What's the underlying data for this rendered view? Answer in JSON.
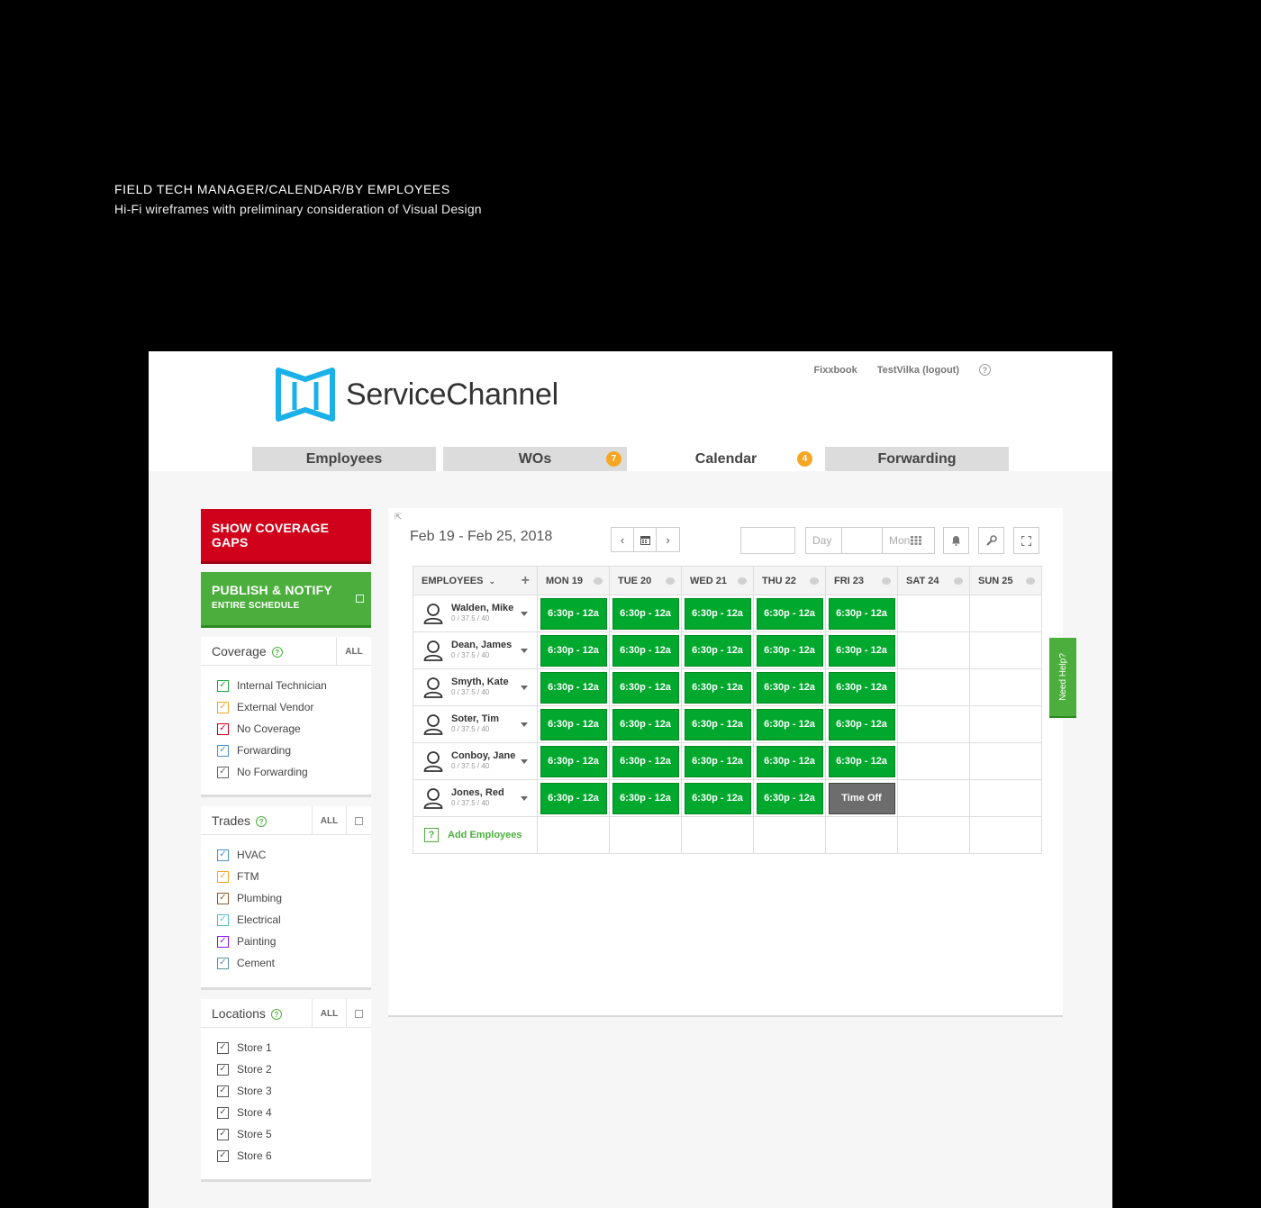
{
  "caption": {
    "title": "FIELD TECH MANAGER/CALENDAR/BY EMPLOYEES",
    "subtitle": "Hi-Fi wireframes with preliminary consideration of Visual Design"
  },
  "brand": {
    "name": "ServiceChannel",
    "accent": "#1ab0e8"
  },
  "toplinks": {
    "link1": "Fixxbook",
    "link2": "TestVilka (logout)",
    "help": "?"
  },
  "tabs": [
    {
      "label": "Employees",
      "badge": ""
    },
    {
      "label": "WOs",
      "badge": "7"
    },
    {
      "label": "Calendar",
      "badge": "4"
    },
    {
      "label": "Forwarding",
      "badge": ""
    }
  ],
  "sidebar": {
    "coverage_gaps_label": "SHOW COVERAGE GAPS",
    "publish_label": "PUBLISH & NOTIFY",
    "publish_sub": "ENTIRE SCHEDULE",
    "coverage": {
      "title": "Coverage",
      "all": "ALL",
      "items": [
        {
          "label": "Internal Technician",
          "color": "#1fa83c"
        },
        {
          "label": "External Vendor",
          "color": "#f5a623"
        },
        {
          "label": "No Coverage",
          "color": "#d0021b"
        },
        {
          "label": "Forwarding",
          "color": "#4a90d9"
        },
        {
          "label": "No Forwarding",
          "color": "#666666"
        }
      ]
    },
    "trades": {
      "title": "Trades",
      "all": "ALL",
      "items": [
        {
          "label": "HVAC",
          "color": "#4a90d9"
        },
        {
          "label": "FTM",
          "color": "#f5a623"
        },
        {
          "label": "Plumbing",
          "color": "#8b5a2b"
        },
        {
          "label": "Electrical",
          "color": "#50b8d8"
        },
        {
          "label": "Painting",
          "color": "#9013fe"
        },
        {
          "label": "Cement",
          "color": "#5a8fa8"
        }
      ]
    },
    "locations": {
      "title": "Locations",
      "all": "ALL",
      "items": [
        {
          "label": "Store 1"
        },
        {
          "label": "Store 2"
        },
        {
          "label": "Store 3"
        },
        {
          "label": "Store 4"
        },
        {
          "label": "Store 5"
        },
        {
          "label": "Store 6"
        }
      ]
    }
  },
  "calendar": {
    "date_range": "Feb 19 - Feb 25, 2018",
    "view_day": "Day",
    "view_month": "Mon",
    "employees_header": "EMPLOYEES",
    "days": [
      "MON 19",
      "TUE 20",
      "WED 21",
      "THU 22",
      "FRI 23",
      "SAT 24",
      "SUN 25"
    ],
    "rows": [
      {
        "name": "Walden, Mike",
        "hours": "0 / 37.5 / 40",
        "shifts": [
          "6:30p - 12a",
          "6:30p - 12a",
          "6:30p - 12a",
          "6:30p - 12a",
          "6:30p - 12a",
          "",
          ""
        ]
      },
      {
        "name": "Dean, James",
        "hours": "0 / 37.5 / 40",
        "shifts": [
          "6:30p - 12a",
          "6:30p - 12a",
          "6:30p - 12a",
          "6:30p - 12a",
          "6:30p - 12a",
          "",
          ""
        ]
      },
      {
        "name": "Smyth, Kate",
        "hours": "0 / 37.5 / 40",
        "shifts": [
          "6:30p - 12a",
          "6:30p - 12a",
          "6:30p - 12a",
          "6:30p - 12a",
          "6:30p - 12a",
          "",
          ""
        ]
      },
      {
        "name": "Soter, Tim",
        "hours": "0 / 37.5 / 40",
        "shifts": [
          "6:30p - 12a",
          "6:30p - 12a",
          "6:30p - 12a",
          "6:30p - 12a",
          "6:30p - 12a",
          "",
          ""
        ]
      },
      {
        "name": "Conboy, Jane",
        "hours": "0 / 37.5 / 40",
        "shifts": [
          "6:30p - 12a",
          "6:30p - 12a",
          "6:30p - 12a",
          "6:30p - 12a",
          "6:30p - 12a",
          "",
          ""
        ]
      },
      {
        "name": "Jones, Red",
        "hours": "0 / 37.5 / 40",
        "shifts": [
          "6:30p - 12a",
          "6:30p - 12a",
          "6:30p - 12a",
          "6:30p - 12a",
          "Time Off",
          "",
          ""
        ]
      }
    ],
    "add_employees": "Add Employees"
  },
  "need_help": "Need Help?"
}
